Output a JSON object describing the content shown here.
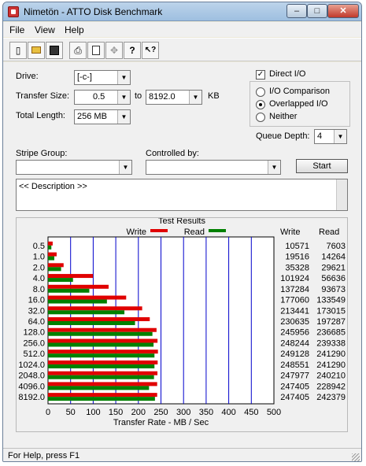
{
  "window": {
    "title": "Nimetön - ATTO Disk Benchmark",
    "controls": {
      "minimize": "–",
      "maximize": "□",
      "close": "✕"
    }
  },
  "menu": {
    "file": "File",
    "view": "View",
    "help": "Help"
  },
  "toolbar": {
    "icons": [
      "new-icon",
      "open-icon",
      "save-icon",
      "print-icon",
      "print-preview-icon",
      "move-icon",
      "help-icon",
      "context-help-icon"
    ],
    "glyphs": {
      "new": "▯",
      "open": "📂",
      "save": "▪",
      "print": "⎙",
      "preview": "🔍",
      "move": "✥",
      "help": "?",
      "context_help": "↖?"
    }
  },
  "form": {
    "drive_label": "Drive:",
    "drive_value": "[-c-]",
    "transfer_size_label": "Transfer Size:",
    "transfer_from": "0.5",
    "to_label": "to",
    "transfer_to": "8192.0",
    "kb_label": "KB",
    "total_length_label": "Total Length:",
    "total_length_value": "256 MB",
    "direct_io_label": "Direct I/O",
    "direct_io_checked": true,
    "io_options": [
      {
        "label": "I/O Comparison",
        "selected": false
      },
      {
        "label": "Overlapped I/O",
        "selected": true
      },
      {
        "label": "Neither",
        "selected": false
      }
    ],
    "queue_depth_label": "Queue Depth:",
    "queue_depth_value": "4",
    "stripe_group_label": "Stripe Group:",
    "stripe_group_value": "",
    "controlled_by_label": "Controlled by:",
    "controlled_by_value": "",
    "start_button": "Start",
    "description": "<< Description >>"
  },
  "chart_data": {
    "type": "bar",
    "title": "Test Results",
    "xlabel": "Transfer Rate - MB / Sec",
    "xlim": [
      0,
      500
    ],
    "xticks": [
      "0",
      "50",
      "100",
      "150",
      "200",
      "250",
      "300",
      "350",
      "400",
      "450",
      "500"
    ],
    "grid": true,
    "legend_placement": "top",
    "categories": [
      "0.5",
      "1.0",
      "2.0",
      "4.0",
      "8.0",
      "16.0",
      "32.0",
      "64.0",
      "128.0",
      "256.0",
      "512.0",
      "1024.0",
      "2048.0",
      "4096.0",
      "8192.0"
    ],
    "series": [
      {
        "name": "Write",
        "color": "#e00000",
        "values": [
          10.3,
          19.1,
          34.5,
          99.5,
          134.1,
          173.0,
          208.4,
          225.2,
          240.2,
          242.4,
          243.3,
          242.7,
          242.2,
          241.6,
          241.6
        ]
      },
      {
        "name": "Read",
        "color": "#008000",
        "values": [
          7.4,
          13.9,
          28.9,
          55.3,
          91.4,
          130.4,
          169.1,
          192.6,
          231.1,
          233.6,
          235.6,
          235.6,
          234.6,
          223.6,
          236.7
        ]
      }
    ],
    "table_headers": {
      "write": "Write",
      "read": "Read"
    },
    "table_write": [
      "10571",
      "19516",
      "35328",
      "101924",
      "137284",
      "177060",
      "213441",
      "230635",
      "245956",
      "248244",
      "249128",
      "248551",
      "247977",
      "247405",
      "247405"
    ],
    "table_read": [
      "7603",
      "14264",
      "29621",
      "56636",
      "93673",
      "133549",
      "173015",
      "197287",
      "236685",
      "239338",
      "241290",
      "241290",
      "240210",
      "228942",
      "242379"
    ]
  },
  "status": {
    "text": "For Help, press F1"
  }
}
